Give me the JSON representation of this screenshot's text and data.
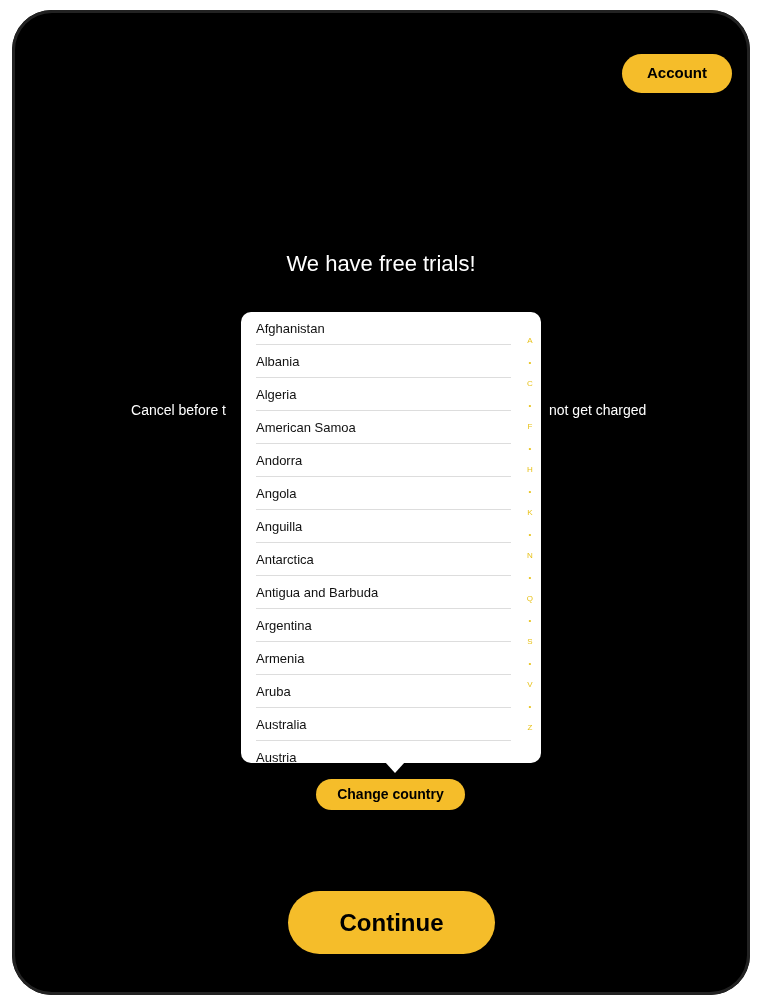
{
  "account_button": "Account",
  "title": "We have free trials!",
  "subtitle": {
    "left": "Cancel before t",
    "right": "not get charged"
  },
  "country_picker": {
    "countries": [
      "Afghanistan",
      "Albania",
      "Algeria",
      "American Samoa",
      "Andorra",
      "Angola",
      "Anguilla",
      "Antarctica",
      "Antigua and Barbuda",
      "Argentina",
      "Armenia",
      "Aruba",
      "Australia",
      "Austria"
    ],
    "index": [
      "A",
      "•",
      "C",
      "•",
      "F",
      "•",
      "H",
      "•",
      "K",
      "•",
      "N",
      "•",
      "Q",
      "•",
      "S",
      "•",
      "V",
      "•",
      "Z"
    ]
  },
  "change_country_button": "Change country",
  "continue_button": "Continue"
}
